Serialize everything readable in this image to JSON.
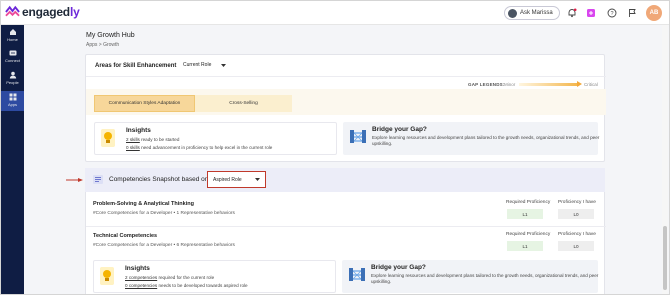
{
  "app": {
    "brand": "engagedly",
    "brand_main": "engaged",
    "brand_accent": "ly"
  },
  "topbar": {
    "ask_label": "Ask Marissa",
    "user_initials": "AB"
  },
  "sidenav": {
    "items": [
      {
        "label": "Home",
        "icon": "home-icon"
      },
      {
        "label": "Connect",
        "icon": "connect-icon"
      },
      {
        "label": "People",
        "icon": "people-icon"
      },
      {
        "label": "Apps",
        "icon": "apps-icon",
        "active": true
      }
    ]
  },
  "page": {
    "title": "My Growth Hub",
    "breadcrumb": "Apps > Growth"
  },
  "areas": {
    "title": "Areas for Skill Enhancement",
    "role_select": "Current Role",
    "gap_legend_label": "GAP LEGENDS:",
    "gap_minor": "Minor",
    "gap_critical": "Critical",
    "tabs": [
      "Communication Styles Adaptation",
      "Cross-Selling"
    ],
    "insights": {
      "title": "Insights",
      "line1_link": "2 skills",
      "line1_text": "ready to be started",
      "line2_link": "0 skills",
      "line2_text": "need advancement in proficiency to help excel in the current role"
    },
    "bridge": {
      "title": "Bridge your Gap?",
      "text": "Explore learning resources and development plans tailored to the growth needs, organizational trends, and peer upskilling."
    }
  },
  "competencies": {
    "label": "Competencies Snapshot based on",
    "role_select": "Aspired Role",
    "required_header": "Required Proficiency",
    "have_header": "Proficiency I have",
    "rows": [
      {
        "name": "Problem-Solving & Analytical Thinking",
        "sub": "#Core Competencies for a Developer  •  1 Representative behaviors",
        "required": "L1",
        "have": "L0"
      },
      {
        "name": "Technical Competencies",
        "sub": "#Core Competencies for a Developer  •  6 Representative behaviors",
        "required": "L1",
        "have": "L0"
      }
    ],
    "insights": {
      "title": "Insights",
      "line1_link": "2 competencies",
      "line1_text": "required for the current role",
      "line2_link": "0 competencies",
      "line2_text": "needs to be developed towards aspired role"
    },
    "bridge": {
      "title": "Bridge your Gap?",
      "text": "Explore learning resources and development plans tailored to the growth needs, organizational trends, and peer upskilling."
    }
  },
  "colors": {
    "sidenav_bg": "#0f1d44",
    "accent": "#6d28d9",
    "selected_tab": "#f7d79a",
    "highlight_border": "#c0392b"
  }
}
